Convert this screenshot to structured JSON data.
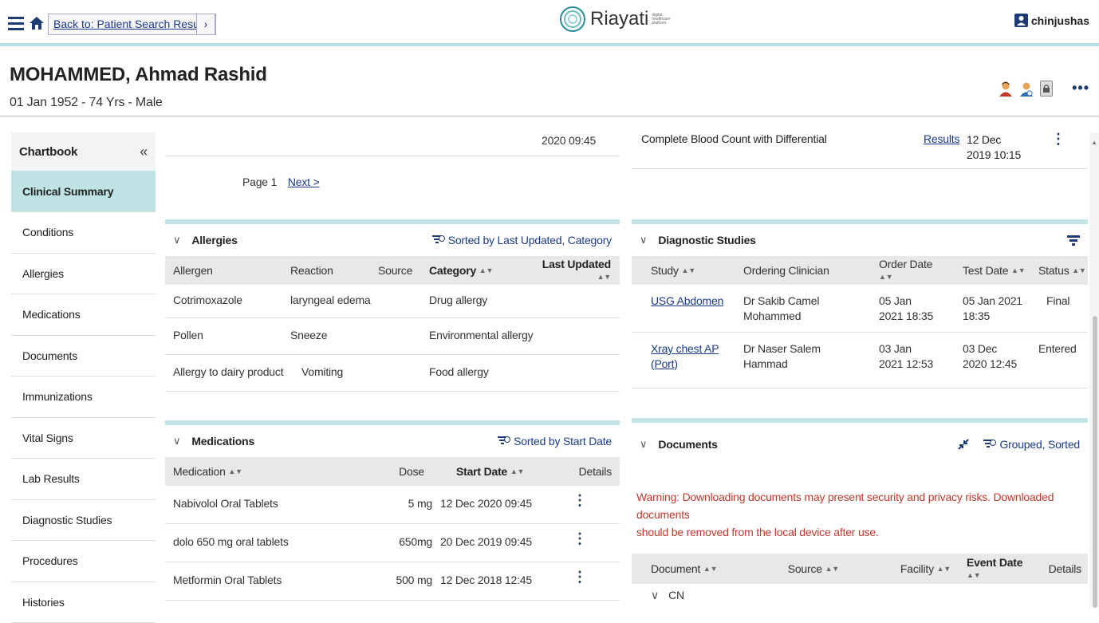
{
  "topbar": {
    "back_label": "Back to: Patient Search Results",
    "back_chevron": "›",
    "brand_name": "Riayati",
    "brand_tagline": "digital healthcare platform",
    "username": "chinjushas"
  },
  "patient": {
    "name": "MOHAMMED, Ahmad Rashid",
    "info": "01 Jan 1952 - 74 Yrs - Male",
    "more": "•••"
  },
  "sidebar": {
    "title": "Chartbook",
    "collapse": "«",
    "items": [
      {
        "label": "Clinical Summary"
      },
      {
        "label": "Conditions"
      },
      {
        "label": "Allergies"
      },
      {
        "label": "Medications"
      },
      {
        "label": "Documents"
      },
      {
        "label": "Immunizations"
      },
      {
        "label": "Vital Signs"
      },
      {
        "label": "Lab Results"
      },
      {
        "label": "Diagnostic Studies"
      },
      {
        "label": "Procedures"
      },
      {
        "label": "Histories"
      }
    ]
  },
  "top_left_fragment": {
    "date_tail": "2020 09:45",
    "page_label": "Page 1",
    "next_label": "Next >"
  },
  "top_right_fragment": {
    "test_name": "Complete Blood Count with Differential",
    "results_link": "Results",
    "date_line1": "12 Dec",
    "date_line2": "2019 10:15"
  },
  "allergies": {
    "title": "Allergies",
    "sort_note": "Sorted by Last Updated, Category",
    "headers": {
      "allergen": "Allergen",
      "reaction": "Reaction",
      "source": "Source",
      "category": "Category",
      "updated": "Last Updated"
    },
    "rows": [
      {
        "allergen": "Cotrimoxazole",
        "reaction": "laryngeal edema",
        "category": "Drug allergy"
      },
      {
        "allergen": "Pollen",
        "reaction": "Sneeze",
        "category": "Environmental allergy"
      },
      {
        "allergen": "Allergy to dairy product",
        "reaction": "Vomiting",
        "category": "Food allergy"
      }
    ]
  },
  "medications": {
    "title": "Medications",
    "sort_note": "Sorted by Start Date",
    "headers": {
      "medication": "Medication",
      "dose": "Dose",
      "start": "Start Date",
      "details": "Details"
    },
    "rows": [
      {
        "medication": "Nabivolol Oral Tablets",
        "dose": "5 mg",
        "start": "12 Dec 2020 09:45"
      },
      {
        "medication": "dolo 650 mg oral tablets",
        "dose": "650mg",
        "start": "20 Dec 2019 09:45"
      },
      {
        "medication": "Metformin Oral Tablets",
        "dose": "500 mg",
        "start": "12 Dec 2018 12:45"
      }
    ]
  },
  "diagnostic": {
    "title": "Diagnostic Studies",
    "headers": {
      "study": "Study",
      "clinician": "Ordering Clinician",
      "order": "Order Date",
      "test": "Test Date",
      "status": "Status"
    },
    "rows": [
      {
        "study_l1": "USG Abdomen",
        "study_l2": "",
        "clin_l1": "Dr Sakib Camel",
        "clin_l2": "Mohammed",
        "order_l1": "05 Jan",
        "order_l2": "2021 18:35",
        "test_l1": "05 Jan 2021 18:35",
        "test_l2": "",
        "status": "Final"
      },
      {
        "study_l1": "Xray chest AP",
        "study_l2": "(Port)",
        "clin_l1": "Dr Naser Salem Hammad",
        "clin_l2": "",
        "order_l1": "03 Jan",
        "order_l2": "2021 12:53",
        "test_l1": "03 Dec",
        "test_l2": "2020 12:45",
        "status": "Entered"
      }
    ]
  },
  "documents": {
    "title": "Documents",
    "sort_note": "Grouped, Sorted",
    "warning_l1": "Warning: Downloading documents may present security and privacy risks. Downloaded documents",
    "warning_l2": "should be removed from the local device after use.",
    "headers": {
      "document": "Document",
      "source": "Source",
      "facility": "Facility",
      "event": "Event Date",
      "details": "Details"
    },
    "group": "CN"
  },
  "colors": {
    "accent": "#1f3b73",
    "teal": "#bfe3e4",
    "warning": "#c0392b"
  }
}
